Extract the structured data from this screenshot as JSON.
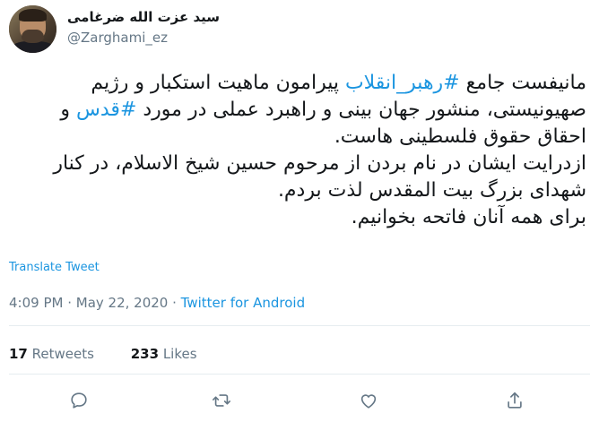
{
  "author": {
    "display_name": "سید عزت الله ضرغامی",
    "handle": "@Zarghami_ez"
  },
  "tweet": {
    "line1_pre": "مانیفست جامع ",
    "hashtag1": "#رهبر_انقلاب",
    "line1_post": " پیرامون ماهیت استکبار و رژیم صهیونیستی، منشور جهان بینی و راهبرد عملی در مورد ",
    "hashtag2": "#قدس",
    "line1_end": " و احقاق حقوق فلسطینی هاست.",
    "paragraph2": "ازدرایت ایشان در نام بردن از مرحوم حسین شیخ الاسلام، در کنار شهدای بزرگ بیت المقدس لذت بردم.",
    "paragraph3": "برای همه آنان فاتحه بخوانیم."
  },
  "translate_label": "Translate Tweet",
  "meta": {
    "time": "4:09 PM",
    "sep1": " · ",
    "date": "May 22, 2020",
    "sep2": " · ",
    "source": "Twitter for Android"
  },
  "stats": {
    "retweets_count": "17",
    "retweets_label": "Retweets",
    "likes_count": "233",
    "likes_label": "Likes"
  },
  "icons": [
    "reply-icon",
    "retweet-icon",
    "like-icon",
    "share-icon"
  ]
}
